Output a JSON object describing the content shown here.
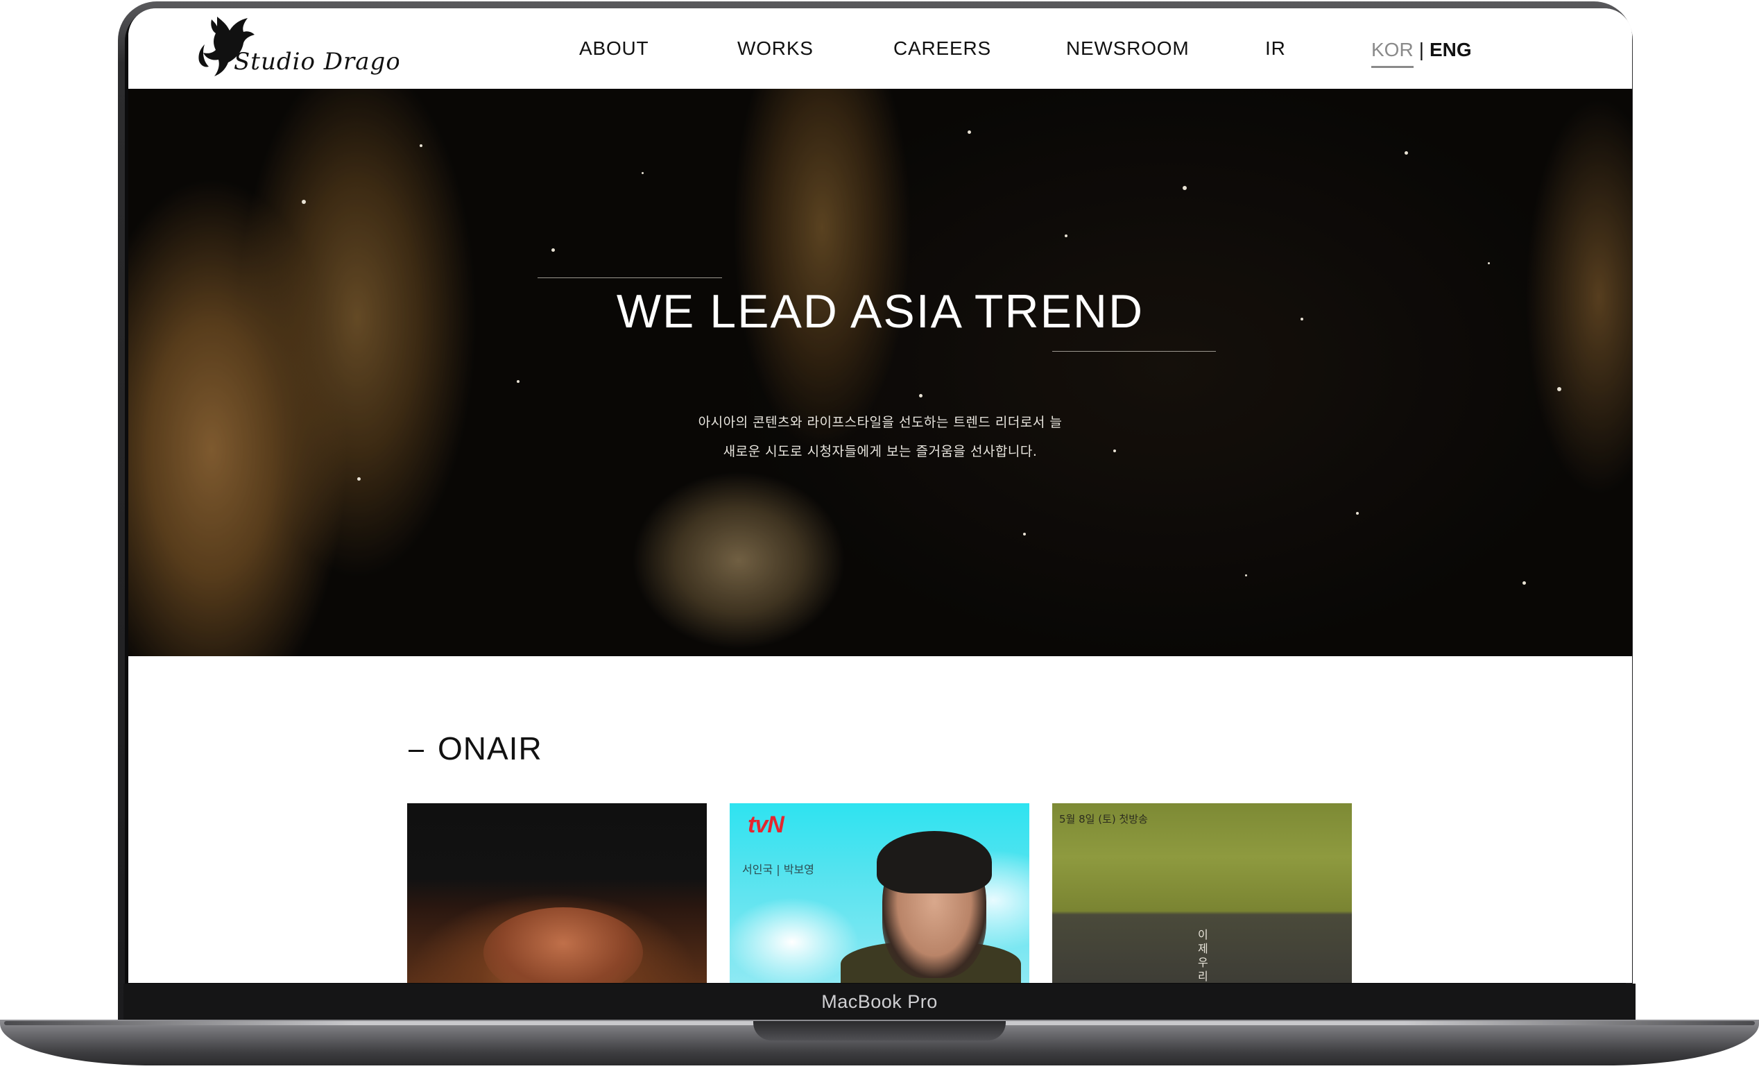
{
  "device": {
    "label": "MacBook Pro"
  },
  "header": {
    "logo_alt": "Studio Dragon",
    "nav": [
      {
        "label": "ABOUT"
      },
      {
        "label": "WORKS"
      },
      {
        "label": "CAREERS"
      },
      {
        "label": "NEWSROOM"
      },
      {
        "label": "IR"
      }
    ],
    "lang": {
      "kor": "KOR",
      "separator": "|",
      "eng": "ENG",
      "active": "KOR"
    }
  },
  "hero": {
    "title": "WE LEAD ASIA TREND",
    "subtitle_line1": "아시아의 콘텐츠와 라이프스타일을 선도하는 트렌드 리더로서 늘",
    "subtitle_line2": "새로운 시도로 시청자들에게 보는 즐거움을 선사합니다."
  },
  "onair": {
    "title": "ONAIR",
    "cards": [
      {
        "network": "",
        "text": ""
      },
      {
        "network": "tvN",
        "text": "서인국 | 박보영"
      },
      {
        "network": "",
        "text": "5월 8일 (토) 첫방송",
        "vertical_text": "이제우리"
      }
    ]
  },
  "colors": {
    "accent_tvn": "#e3262f",
    "text_dark": "#111111",
    "lang_inactive": "#8a8a8a"
  }
}
